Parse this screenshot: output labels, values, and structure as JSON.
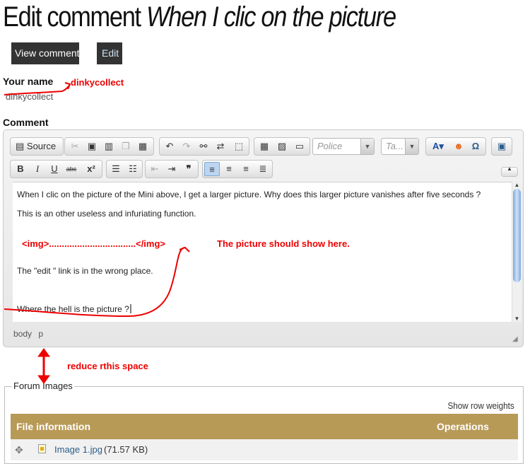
{
  "page": {
    "title_prefix": "Edit comment",
    "title_subject": "When I clic on the picture"
  },
  "tabs": {
    "view": "View comment",
    "edit": "Edit"
  },
  "form": {
    "name_label": "Your name",
    "name_value": "dinkycollect",
    "comment_label": "Comment"
  },
  "toolbar": {
    "source": "Source",
    "format_combo": "Police",
    "size_combo": "Ta..."
  },
  "content": {
    "line1": "When I clic on the picture of the Mini above, I get a larger picture. Why does this larger picture vanishes after five seconds ?",
    "line2": "This is an other useless and infuriating function.",
    "img_placeholder": "<img>..................................</img>",
    "line3": "The \"edit \" link is in the wrong place.",
    "line4": "Where the hell is the picture ?"
  },
  "elements_path": "body p",
  "annotations": {
    "name": "dinkycollect",
    "picture": "The picture should show here.",
    "space": "reduce rthis space"
  },
  "forum_images": {
    "legend": "Forum Images",
    "row_weights": "Show row weights",
    "columns": [
      "File information",
      "Operations"
    ],
    "rows": [
      {
        "file": "Image 1.jpg",
        "size": "(71.57 KB)"
      }
    ]
  },
  "colors": {
    "annotation": "#e00000",
    "table_header": "#b89a57",
    "tab_bg": "#333333",
    "link": "#2a5d8a"
  },
  "icons": [
    "cut-icon",
    "paste-text-icon",
    "paste-word-icon",
    "copy-icon",
    "paste-icon",
    "undo-icon",
    "redo-icon",
    "find-icon",
    "replace-icon",
    "select-all-icon",
    "table-icon",
    "image-icon",
    "horizontal-rule-icon",
    "text-color-icon",
    "smiley-icon",
    "special-char-icon",
    "maximize-icon",
    "numbered-list-icon",
    "bulleted-list-icon",
    "outdent-icon",
    "indent-icon",
    "blockquote-icon",
    "align-left-icon",
    "align-center-icon",
    "align-right-icon",
    "justify-icon",
    "drag-handle-icon",
    "image-file-icon"
  ]
}
